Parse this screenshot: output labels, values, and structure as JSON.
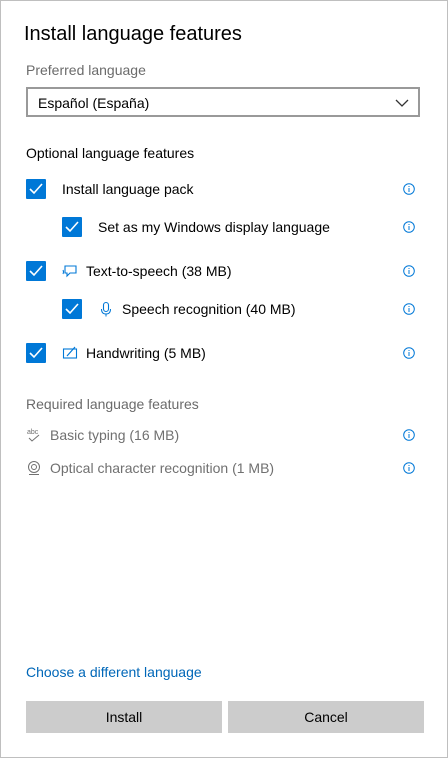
{
  "dialog": {
    "title": "Install language features",
    "preferred_label": "Preferred language",
    "preferred_value": "Español (España)",
    "optional_heading": "Optional language features",
    "required_heading": "Required language features",
    "link_label": "Choose a different language",
    "install_label": "Install",
    "cancel_label": "Cancel"
  },
  "optional": [
    {
      "label": "Install language pack",
      "checked": true,
      "icon": "none"
    },
    {
      "label": "Set as my Windows display language",
      "checked": true,
      "icon": "none"
    },
    {
      "label": "Text-to-speech (38 MB)",
      "checked": true,
      "icon": "speech-bubble-icon"
    },
    {
      "label": "Speech recognition (40 MB)",
      "checked": true,
      "icon": "microphone-icon"
    },
    {
      "label": "Handwriting (5 MB)",
      "checked": true,
      "icon": "pen-icon"
    }
  ],
  "required": [
    {
      "label": "Basic typing (16 MB)",
      "icon": "abc-check-icon"
    },
    {
      "label": "Optical character recognition (1 MB)",
      "icon": "ocr-icon"
    }
  ],
  "colors": {
    "accent": "#0078d7",
    "link": "#0067b8",
    "button_bg": "#cccccc"
  }
}
